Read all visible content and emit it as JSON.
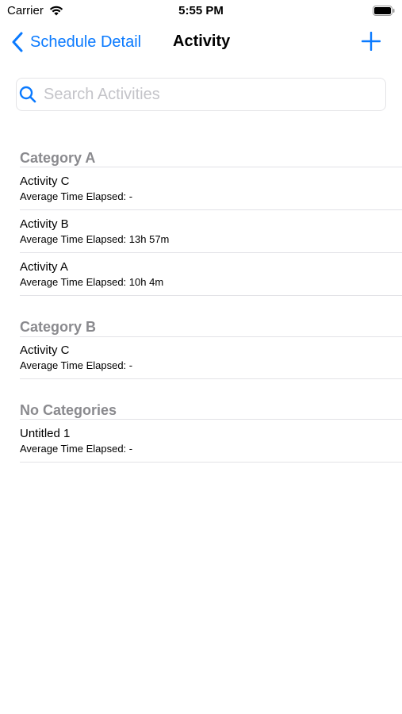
{
  "status_bar": {
    "carrier": "Carrier",
    "time": "5:55 PM"
  },
  "nav": {
    "back_label": "Schedule Detail",
    "title": "Activity",
    "add_icon": "plus-icon",
    "accent_color": "#0a7aff"
  },
  "search": {
    "placeholder": "Search Activities",
    "value": ""
  },
  "sections": [
    {
      "header": "Category A",
      "items": [
        {
          "title": "Activity C",
          "subtitle": "Average Time Elapsed: -"
        },
        {
          "title": "Activity B",
          "subtitle": "Average Time Elapsed: 13h 57m"
        },
        {
          "title": "Activity A",
          "subtitle": "Average Time Elapsed: 10h 4m"
        }
      ]
    },
    {
      "header": "Category B",
      "items": [
        {
          "title": "Activity C",
          "subtitle": "Average Time Elapsed: -"
        }
      ]
    },
    {
      "header": "No Categories",
      "items": [
        {
          "title": "Untitled 1",
          "subtitle": "Average Time Elapsed: -"
        }
      ]
    }
  ]
}
